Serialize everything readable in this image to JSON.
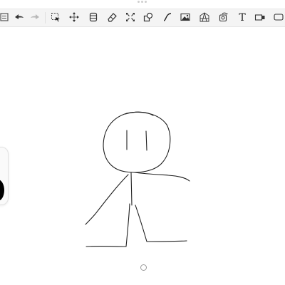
{
  "toolbar": {
    "tools": [
      {
        "icon": "menu-icon"
      },
      {
        "icon": "undo-icon"
      },
      {
        "icon": "redo-icon"
      },
      {
        "icon": "select-icon"
      },
      {
        "icon": "move-icon"
      },
      {
        "icon": "layers-icon"
      },
      {
        "icon": "eraser-icon"
      },
      {
        "icon": "transform-icon"
      },
      {
        "icon": "shapes-icon"
      },
      {
        "icon": "curve-icon"
      },
      {
        "icon": "image-icon"
      },
      {
        "icon": "perspective-grid-icon"
      },
      {
        "icon": "symmetry-icon"
      },
      {
        "icon": "text-icon"
      },
      {
        "icon": "fill-icon"
      },
      {
        "icon": "fullscreen-icon"
      }
    ],
    "text_tool_label": "T"
  },
  "colors": {
    "stroke": "#1e1e1e",
    "current_color": "#000000",
    "toolbar_bg": "#f4f4f4"
  },
  "canvas": {
    "drawing": "stick-figure-sketch"
  }
}
